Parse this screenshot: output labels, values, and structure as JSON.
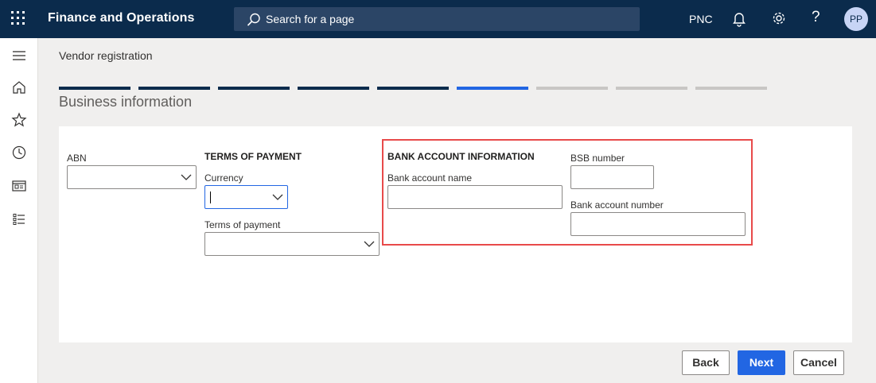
{
  "header": {
    "app_title": "Finance and Operations",
    "search_placeholder": "Search for a page",
    "company": "PNC",
    "help_label": "?",
    "avatar_initials": "PP"
  },
  "page": {
    "title": "Vendor registration",
    "section_title": "Business information"
  },
  "wizard": {
    "step_count": 9,
    "current_step": 6,
    "completed_steps": 5
  },
  "form": {
    "abn": {
      "label": "ABN",
      "value": ""
    },
    "terms": {
      "heading": "TERMS OF PAYMENT",
      "currency_label": "Currency",
      "currency_value": "",
      "terms_label": "Terms of payment",
      "terms_value": ""
    },
    "bank": {
      "heading": "BANK ACCOUNT INFORMATION",
      "account_name_label": "Bank account name",
      "account_name_value": "",
      "bsb_label": "BSB number",
      "bsb_value": "",
      "account_number_label": "Bank account number",
      "account_number_value": ""
    }
  },
  "actions": {
    "back": "Back",
    "next": "Next",
    "cancel": "Cancel"
  },
  "colors": {
    "topbar": "#0b2b4c",
    "accent": "#2266e3",
    "highlight": "#e84a4a"
  }
}
